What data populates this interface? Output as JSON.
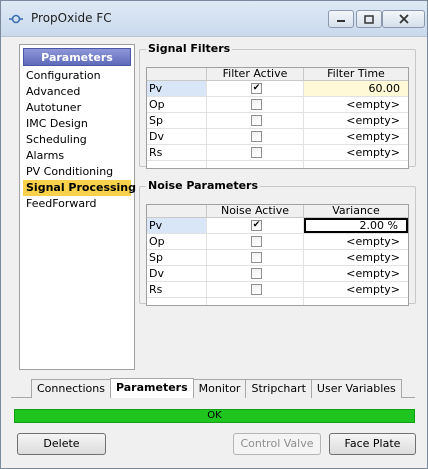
{
  "window": {
    "title": "PropOxide FC"
  },
  "nav": {
    "header": "Parameters",
    "items": [
      {
        "label": "Configuration"
      },
      {
        "label": "Advanced"
      },
      {
        "label": "Autotuner"
      },
      {
        "label": "IMC Design"
      },
      {
        "label": "Scheduling"
      },
      {
        "label": "Alarms"
      },
      {
        "label": "PV Conditioning"
      },
      {
        "label": "Signal Processing",
        "selected": true
      },
      {
        "label": "FeedForward"
      }
    ]
  },
  "signal_filters": {
    "title": "Signal Filters",
    "columns": [
      "",
      "Filter Active",
      "Filter Time"
    ],
    "rows": [
      {
        "name": "Pv",
        "active": true,
        "value": "60.00"
      },
      {
        "name": "Op",
        "active": false,
        "value": "<empty>"
      },
      {
        "name": "Sp",
        "active": false,
        "value": "<empty>"
      },
      {
        "name": "Dv",
        "active": false,
        "value": "<empty>"
      },
      {
        "name": "Rs",
        "active": false,
        "value": "<empty>"
      }
    ]
  },
  "noise_parameters": {
    "title": "Noise Parameters",
    "columns": [
      "",
      "Noise Active",
      "Variance"
    ],
    "rows": [
      {
        "name": "Pv",
        "active": true,
        "value": "2.00 %"
      },
      {
        "name": "Op",
        "active": false,
        "value": "<empty>"
      },
      {
        "name": "Sp",
        "active": false,
        "value": "<empty>"
      },
      {
        "name": "Dv",
        "active": false,
        "value": "<empty>"
      },
      {
        "name": "Rs",
        "active": false,
        "value": "<empty>"
      }
    ]
  },
  "tabs": [
    {
      "label": "Connections",
      "active": false
    },
    {
      "label": "Parameters",
      "active": true
    },
    {
      "label": "Monitor",
      "active": false
    },
    {
      "label": "Stripchart",
      "active": false
    },
    {
      "label": "User Variables",
      "active": false
    }
  ],
  "status": {
    "text": "OK",
    "color": "#1fc41f"
  },
  "buttons": {
    "delete": "Delete",
    "control_valve": "Control Valve",
    "face_plate": "Face Plate"
  },
  "colors": {
    "nav_header": "#5e6ab9",
    "selected_item": "#f8d24a"
  }
}
